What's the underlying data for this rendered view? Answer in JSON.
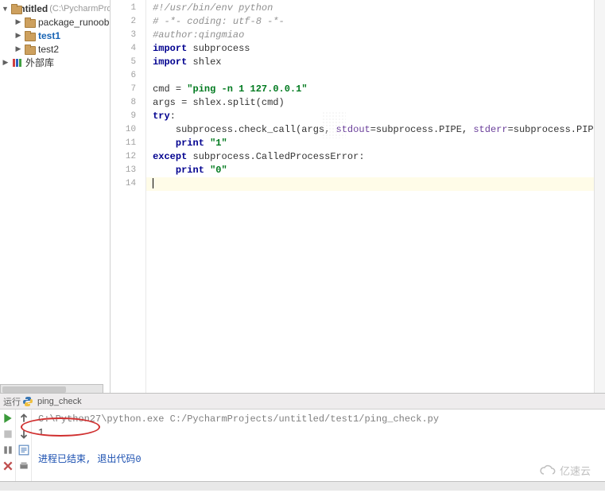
{
  "tree": {
    "root_label": "untitled",
    "root_hint": "(C:\\PycharmProject",
    "items": [
      {
        "label": "package_runoob"
      },
      {
        "label": "test1"
      },
      {
        "label": "test2"
      }
    ],
    "ext_lib": "外部库"
  },
  "code": {
    "line_numbers": [
      "1",
      "2",
      "3",
      "4",
      "5",
      "6",
      "7",
      "8",
      "9",
      "10",
      "11",
      "12",
      "13",
      "14"
    ],
    "l1_comment": "#!/usr/bin/env python",
    "l2_comment": "# -*- coding: utf-8 -*-",
    "l3_comment": "#author:qingmiao",
    "l4_kw": "import",
    "l4_rest": " subprocess",
    "l5_kw": "import",
    "l5_rest": " shlex",
    "l7_a": "cmd = ",
    "l7_str": "\"ping -n 1 127.0.0.1\"",
    "l8": "args = shlex.split(cmd)",
    "l9_kw": "try",
    "l9_rest": ":",
    "l10_a": "    subprocess.check_call(args, ",
    "l10_p1": "stdout",
    "l10_b": "=subprocess.PIPE, ",
    "l10_p2": "stderr",
    "l10_c": "=subprocess.PIPE)",
    "l11_a": "    ",
    "l11_kw": "print",
    "l11_sp": " ",
    "l11_str": "\"1\"",
    "l12_kw": "except",
    "l12_rest": " subprocess.CalledProcessError:",
    "l13_a": "    ",
    "l13_kw": "print",
    "l13_sp": " ",
    "l13_str": "\"0\""
  },
  "run": {
    "label": "运行",
    "tab_name": "ping_check",
    "cmd_line": "C:\\Python27\\python.exe C:/PycharmProjects/untitled/test1/ping_check.py",
    "output_line": "1",
    "end_text": "进程已结束, 退出代码",
    "exit_code": "0"
  },
  "watermark": "亿速云"
}
